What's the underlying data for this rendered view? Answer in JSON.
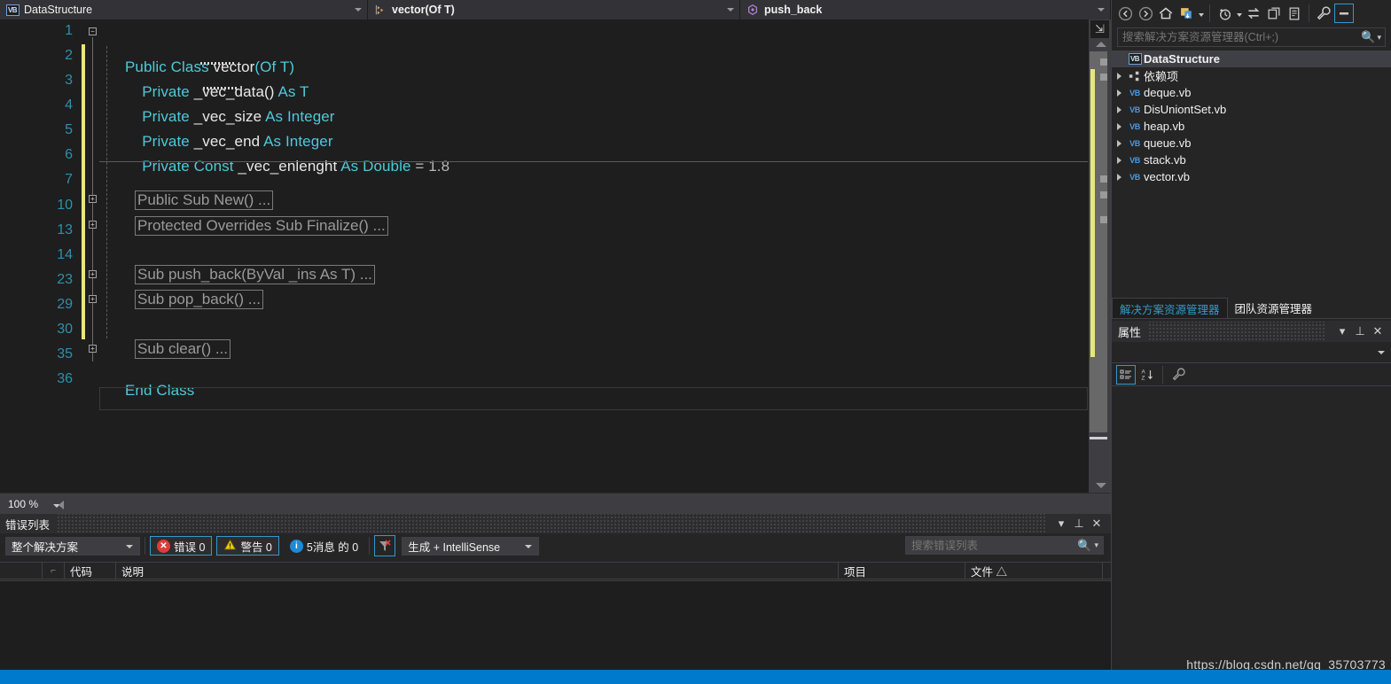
{
  "navbar": {
    "project": {
      "label": "DataStructure",
      "icon": "vb-file-icon"
    },
    "type": {
      "label": "vector(Of T)",
      "icon": "class-icon"
    },
    "member": {
      "label": "push_back",
      "icon": "method-icon"
    }
  },
  "editor": {
    "zoom_level": "100 %",
    "line_numbers": [
      "1",
      "2",
      "3",
      "4",
      "5",
      "6",
      "7",
      "10",
      "13",
      "14",
      "23",
      "29",
      "30",
      "35",
      "36"
    ],
    "lines": [
      {
        "n": "1",
        "segments": [
          {
            "t": "Public Class ",
            "c": "kw"
          },
          {
            "t": "vector",
            "c": "id"
          },
          {
            "t": "(Of ",
            "c": "kw"
          },
          {
            "t": "T",
            "c": "typ"
          },
          {
            "t": ")",
            "c": "kw"
          }
        ]
      },
      {
        "n": "2",
        "segments": [
          {
            "t": "    Private ",
            "c": "kw"
          },
          {
            "t": "_vec_data",
            "c": "id"
          },
          {
            "t": "() ",
            "c": "id"
          },
          {
            "t": "As ",
            "c": "kw"
          },
          {
            "t": "T",
            "c": "typ"
          }
        ]
      },
      {
        "n": "3",
        "segments": [
          {
            "t": "    Private ",
            "c": "kw"
          },
          {
            "t": "_vec_size ",
            "c": "id"
          },
          {
            "t": "As Integer",
            "c": "kw"
          }
        ]
      },
      {
        "n": "4",
        "segments": [
          {
            "t": "    Private ",
            "c": "kw"
          },
          {
            "t": "_vec_end ",
            "c": "id"
          },
          {
            "t": "As Integer",
            "c": "kw"
          }
        ]
      },
      {
        "n": "5",
        "segments": [
          {
            "t": "    Private Const ",
            "c": "kw"
          },
          {
            "t": "_vec_enlenght ",
            "c": "id"
          },
          {
            "t": "As Double ",
            "c": "kw"
          },
          {
            "t": "= ",
            "c": "num"
          },
          {
            "t": "1.8",
            "c": "num"
          }
        ]
      },
      {
        "n": "6",
        "segments": []
      },
      {
        "n": "35",
        "segments": [
          {
            "t": "End Class",
            "c": "kw"
          }
        ]
      },
      {
        "n": "36",
        "segments": []
      }
    ],
    "collapsed_regions": [
      {
        "line": "7",
        "text": "Public Sub New() ..."
      },
      {
        "line": "10",
        "text": "Protected Overrides Sub Finalize() ..."
      },
      {
        "line": "14",
        "text": "Sub push_back(ByVal _ins As T) ..."
      },
      {
        "line": "23",
        "text": "Sub pop_back() ..."
      },
      {
        "line": "30",
        "text": "Sub clear() ..."
      }
    ],
    "colors": {
      "keyword": "#4ec9da",
      "identifier": "#e8e8e8",
      "number": "#b8b8b8",
      "line_number": "#2b91af",
      "change_bar": "#e7e77a",
      "background": "#1e1e1e"
    }
  },
  "error_list": {
    "title": "错误列表",
    "scope_filter": "整个解决方案",
    "errors_label": "错误 0",
    "warnings_label": "警告 0",
    "messages_label": "5消息 的 0",
    "build_filter": "生成 + IntelliSense",
    "search_placeholder": "搜索错误列表",
    "columns": [
      "",
      "",
      "代码",
      "说明",
      "项目",
      "文件 △"
    ],
    "rows": []
  },
  "solution_explorer": {
    "search_placeholder": "搜索解决方案资源管理器(Ctrl+;)",
    "toolbar_icons": [
      "back-icon",
      "forward-icon",
      "home-icon",
      "refresh-icon",
      "pending-changes-icon",
      "sync-icon",
      "collapse-all-icon",
      "show-all-files-icon",
      "properties-icon",
      "preview-selected-items-icon"
    ],
    "tree": [
      {
        "label": "DataStructure",
        "icon": "vb-project-icon",
        "root": true,
        "expandable": false
      },
      {
        "label": "依赖项",
        "icon": "dependencies-icon",
        "root": false,
        "expandable": true
      },
      {
        "label": "deque.vb",
        "icon": "vb-file-icon",
        "root": false,
        "expandable": true
      },
      {
        "label": "DisUniontSet.vb",
        "icon": "vb-file-icon",
        "root": false,
        "expandable": true
      },
      {
        "label": "heap.vb",
        "icon": "vb-file-icon",
        "root": false,
        "expandable": true
      },
      {
        "label": "queue.vb",
        "icon": "vb-file-icon",
        "root": false,
        "expandable": true
      },
      {
        "label": "stack.vb",
        "icon": "vb-file-icon",
        "root": false,
        "expandable": true
      },
      {
        "label": "vector.vb",
        "icon": "vb-file-icon",
        "root": false,
        "expandable": true
      }
    ]
  },
  "dock_tabs": [
    {
      "label": "解决方案资源管理器",
      "active": true
    },
    {
      "label": "团队资源管理器",
      "active": false
    }
  ],
  "properties": {
    "title": "属性",
    "selected_object": "",
    "toolbar_icons": [
      "categorized-icon",
      "alphabetical-icon",
      "properties-icon"
    ]
  },
  "watermark": "https://blog.csdn.net/qq_35703773",
  "colors": {
    "accent": "#3399cc",
    "status_bar": "#007acc",
    "panel_bg": "#252526",
    "editor_bg": "#1e1e1e"
  }
}
